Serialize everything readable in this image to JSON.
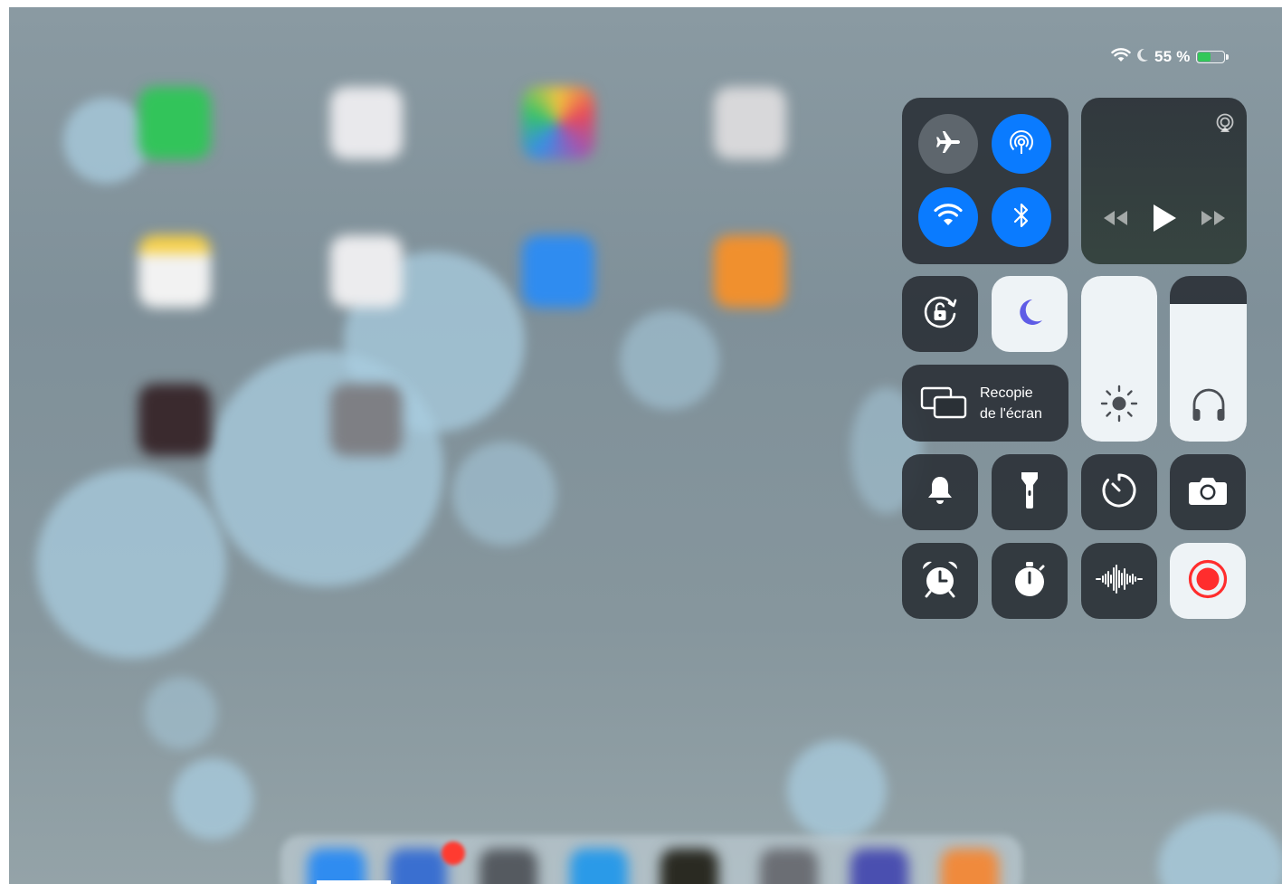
{
  "status_bar": {
    "wifi_icon": "wifi-icon",
    "do_not_disturb_icon": "moon-icon",
    "battery_percent_label": "55 %",
    "battery_level": 0.55,
    "battery_fill_color": "#34c759"
  },
  "control_center": {
    "connectivity": {
      "airplane_mode": {
        "icon": "airplane-icon",
        "active": false
      },
      "airdrop": {
        "icon": "airdrop-icon",
        "active": true
      },
      "wifi": {
        "icon": "wifi-icon",
        "active": true
      },
      "bluetooth": {
        "icon": "bluetooth-icon",
        "active": true
      },
      "active_color": "#0a7bff"
    },
    "now_playing": {
      "airplay_icon": "airplay-icon",
      "prev_icon": "rewind-icon",
      "play_icon": "play-icon",
      "next_icon": "fast-forward-icon"
    },
    "orientation_lock": {
      "icon": "orientation-lock-icon",
      "active": false
    },
    "do_not_disturb": {
      "icon": "moon-icon",
      "active": true,
      "icon_color": "#5e5ce6"
    },
    "screen_mirroring": {
      "label_line1": "Recopie",
      "label_line2": "de l'écran",
      "icon": "screen-mirroring-icon"
    },
    "brightness": {
      "icon": "sun-icon",
      "level": 1.0
    },
    "volume": {
      "icon": "headphones-icon",
      "level": 0.83
    },
    "shortcuts_row1": [
      "bell-icon",
      "flashlight-icon",
      "timer-icon",
      "camera-icon"
    ],
    "shortcuts_row2": [
      "alarm-clock-icon",
      "stopwatch-icon",
      "voice-memos-icon",
      "screen-record-icon"
    ],
    "record_color": "#ff2d2d"
  }
}
